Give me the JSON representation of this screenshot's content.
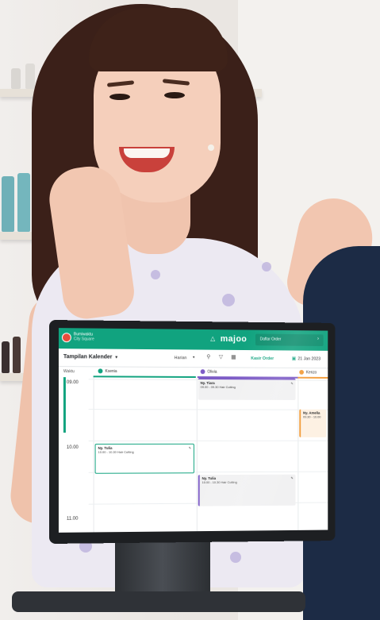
{
  "app": {
    "outlet_name": "Bumiwaktu",
    "outlet_sub": "City Square",
    "brand": "majoo",
    "order_button": "Daftar Order"
  },
  "toolbar": {
    "view_title": "Tampilan Kalender",
    "view_mode": "Harian",
    "link": "Kasir Order",
    "date": "21 Jan 2023"
  },
  "columns": {
    "time_header": "Waktu",
    "staff": [
      {
        "name": "Ksenia",
        "color": "#11a37f"
      },
      {
        "name": "Olivia",
        "color": "#7d5cc6"
      },
      {
        "name": "Kenzo",
        "color": "#f29b38"
      }
    ]
  },
  "time_slots": [
    "09.00",
    "10.00",
    "11.00"
  ],
  "appointments": [
    {
      "name": "Ny. Tiara",
      "time": "09.00 - 09.30",
      "service": "Hair Cutting",
      "color": "#7d5cc6"
    },
    {
      "name": "Ny. Tulia",
      "time": "10.00 - 10.30",
      "service": "Hair Cutting",
      "color": "#11a37f"
    },
    {
      "name": "Ny. Tulia",
      "time": "10.00 - 10.30",
      "service": "Hair Cutting",
      "color": "#7d5cc6"
    },
    {
      "name": "Ny. Amelia",
      "time": "09.30 - 10.00",
      "service": "",
      "color": "#f29b38"
    }
  ],
  "icons": [
    "bell-icon",
    "search-icon",
    "filter-icon",
    "grid-icon",
    "calendar-icon",
    "edit-icon"
  ]
}
